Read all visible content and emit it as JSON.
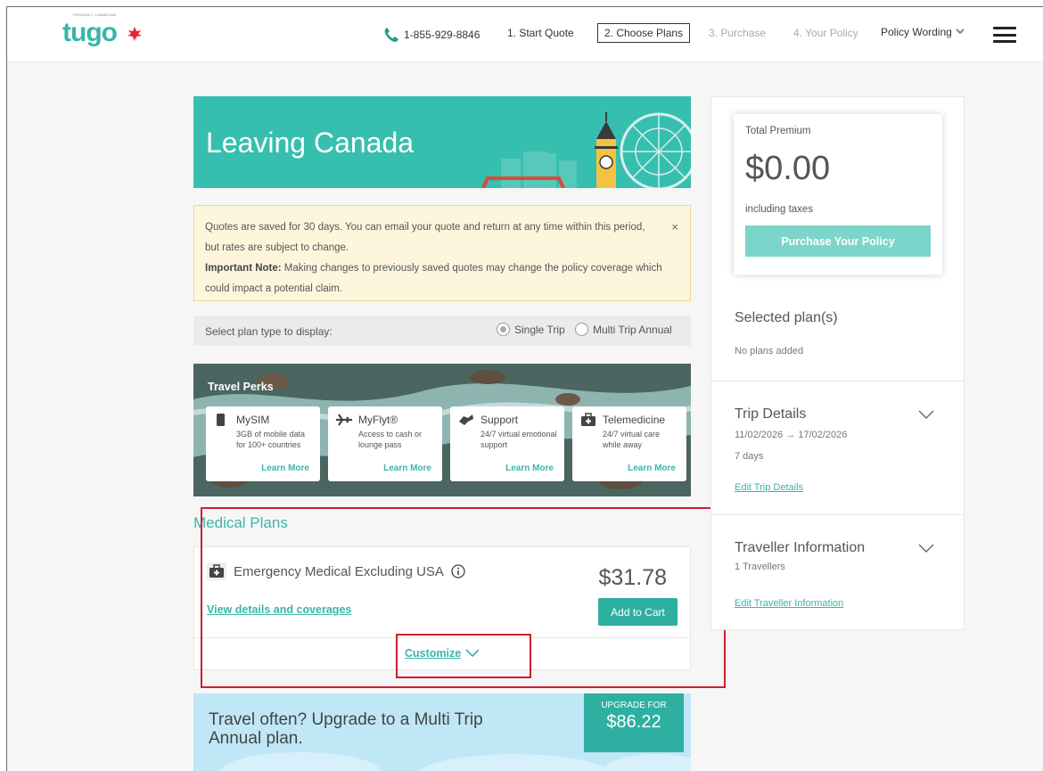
{
  "header": {
    "logo_small_text": "PROUDLY CANADIAN",
    "logo_text": "tugo",
    "phone": "1-855-929-8846",
    "steps": [
      {
        "label": "1. Start Quote"
      },
      {
        "label": "2. Choose Plans"
      },
      {
        "label": "3. Purchase"
      },
      {
        "label": "4. Your Policy"
      }
    ],
    "policy_wording": "Policy Wording"
  },
  "banner": {
    "title": "Leaving Canada"
  },
  "notice": {
    "line1": "Quotes are saved for 30 days. You can email your quote and return at any time within this period, but rates are subject to change.",
    "important_label": "Important Note:",
    "important_text": " Making changes to previously saved quotes may change the policy coverage which could impact a potential claim.",
    "close": "×"
  },
  "plan_type": {
    "label": "Select plan type to display:",
    "options": [
      {
        "label": "Single Trip",
        "selected": true
      },
      {
        "label": "Multi Trip Annual",
        "selected": false
      }
    ]
  },
  "perks": {
    "title": "Travel Perks",
    "cards": [
      {
        "icon": "sim-icon",
        "title": "MySIM",
        "desc": "3GB of mobile data for 100+ countries",
        "link": "Learn More"
      },
      {
        "icon": "plane-icon",
        "title": "MyFlyt®",
        "desc": "Access to cash or lounge pass",
        "link": "Learn More"
      },
      {
        "icon": "support-icon",
        "title": "Support",
        "desc": "24/7 virtual emotional support",
        "link": "Learn More"
      },
      {
        "icon": "medical-kit-icon",
        "title": "Telemedicine",
        "desc": "24/7 virtual care while away",
        "link": "Learn More"
      }
    ]
  },
  "medical": {
    "section_title": "Medical Plans",
    "plan_name": "Emergency Medical Excluding USA",
    "price": "$31.78",
    "details_link": "View details and coverages",
    "add_button": "Add to Cart",
    "customize": "Customize"
  },
  "upgrade": {
    "text": "Travel often? Upgrade to a Multi Trip Annual plan.",
    "badge_label": "UPGRADE FOR",
    "badge_price": "$86.22"
  },
  "sidebar": {
    "premium_label": "Total Premium",
    "premium_amount": "$0.00",
    "premium_note": "including taxes",
    "purchase_button": "Purchase Your Policy",
    "selected_title": "Selected plan(s)",
    "selected_empty": "No plans added",
    "trip_title": "Trip Details",
    "trip_dates": "11/02/2026 → 17/02/2026",
    "trip_days": "7 days",
    "trip_edit": "Edit Trip Details",
    "traveller_title": "Traveller Information",
    "traveller_count": "1 Travellers",
    "traveller_edit": "Edit Traveller Information"
  },
  "colors": {
    "brand": "#3ab5a8",
    "button": "#2fafa1",
    "annotation": "#cc1f2f"
  }
}
